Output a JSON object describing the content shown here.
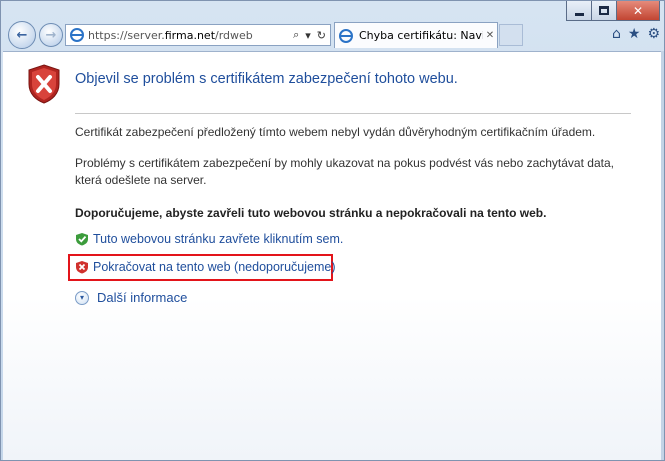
{
  "window": {
    "controls": {
      "minimize": "minimize",
      "maximize": "maximize",
      "close": "✕"
    }
  },
  "nav": {
    "back_icon": "←",
    "forward_icon": "→",
    "address": {
      "prefix": "https://server.",
      "domain": "firma.net",
      "suffix": "/rdweb",
      "search_icon": "⌕",
      "dropdown_icon": "▾",
      "refresh_icon": "↻"
    },
    "tab": {
      "title": "Chyba certifikátu: Navigace...",
      "close_icon": "✕"
    },
    "tools": {
      "home_icon": "⌂",
      "favorites_icon": "★",
      "settings_icon": "⚙"
    }
  },
  "page": {
    "heading": "Objevil se problém s certifikátem zabezpečení tohoto webu.",
    "paragraph1": "Certifikát zabezpečení předložený tímto webem nebyl vydán důvěryhodným certifikačním úřadem.",
    "paragraph2": "Problémy s certifikátem zabezpečení by mohly ukazovat na pokus podvést vás nebo zachytávat data, která odešlete na server.",
    "recommendation": "Doporučujeme, abyste zavřeli tuto webovou stránku a nepokračovali na tento web.",
    "close_link": "Tuto webovou stránku zavřete kliknutím sem.",
    "continue_link": "Pokračovat na tento web (nedoporučujeme)",
    "more_info": "Další informace",
    "more_info_icon": "▾"
  },
  "colors": {
    "link": "#1f4e9c",
    "highlight_border": "#e3141a",
    "shield_red": "#d0312d",
    "shield_green": "#3c9c3c"
  }
}
